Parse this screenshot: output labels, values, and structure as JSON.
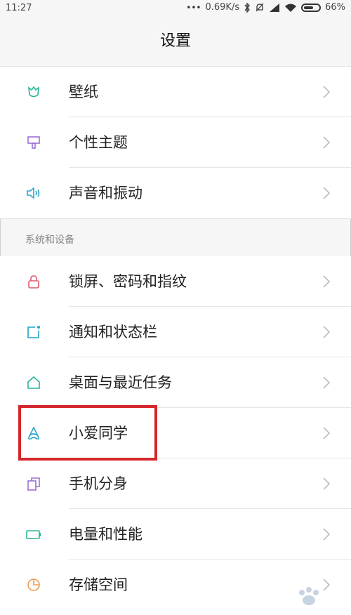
{
  "status_bar": {
    "time": "11:27",
    "network_speed": "0.69K/s",
    "battery_percent": "66%",
    "battery_level": 0.66,
    "icons": [
      "more-dots-icon",
      "bluetooth-icon",
      "mute-icon",
      "signal-icon",
      "wifi-icon",
      "battery-icon"
    ]
  },
  "header": {
    "title": "设置"
  },
  "groups": [
    {
      "items": [
        {
          "label": "壁纸",
          "icon": "wallpaper-icon",
          "color": "#2bb39a"
        },
        {
          "label": "个性主题",
          "icon": "theme-brush-icon",
          "color": "#9b6fd6"
        },
        {
          "label": "声音和振动",
          "icon": "sound-icon",
          "color": "#2aa6c8"
        }
      ]
    },
    {
      "section_title": "系统和设备",
      "items": [
        {
          "label": "锁屏、密码和指纹",
          "icon": "lock-icon",
          "color": "#e05a6e"
        },
        {
          "label": "通知和状态栏",
          "icon": "notification-icon",
          "color": "#21a3c6"
        },
        {
          "label": "桌面与最近任务",
          "icon": "home-icon",
          "color": "#2bb39a"
        },
        {
          "label": "小爱同学",
          "icon": "xiaoai-icon",
          "color": "#2aa6c8"
        },
        {
          "label": "手机分身",
          "icon": "dual-phone-icon",
          "color": "#9b6fd6"
        },
        {
          "label": "电量和性能",
          "icon": "battery-performance-icon",
          "color": "#2bb39a"
        },
        {
          "label": "存储空间",
          "icon": "storage-pie-icon",
          "color": "#f09a4a"
        }
      ]
    }
  ],
  "highlight_color": "#d6262b"
}
